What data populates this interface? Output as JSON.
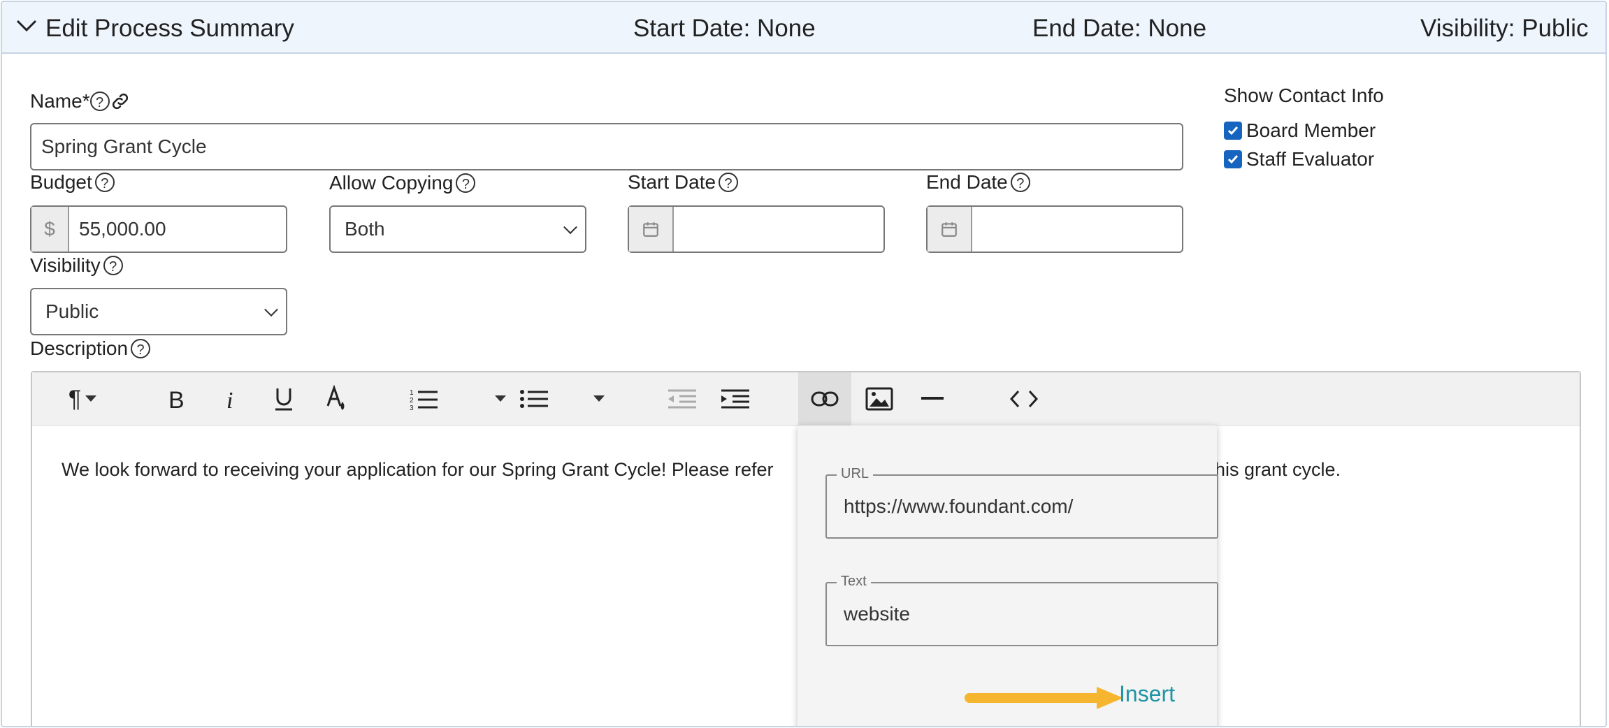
{
  "header": {
    "title": "Edit Process Summary",
    "start_date": "Start Date: None",
    "end_date": "End Date: None",
    "visibility": "Visibility: Public"
  },
  "form": {
    "name_label": "Name*",
    "name_value": "Spring Grant Cycle",
    "budget_label": "Budget",
    "budget_currency": "$",
    "budget_value": "55,000.00",
    "allow_copying_label": "Allow Copying",
    "allow_copying_value": "Both",
    "start_date_label": "Start Date",
    "end_date_label": "End Date",
    "visibility_label": "Visibility",
    "visibility_value": "Public",
    "description_label": "Description",
    "help_glyph": "?"
  },
  "contact": {
    "heading": "Show Contact Info",
    "options": [
      {
        "label": "Board Member",
        "checked": true
      },
      {
        "label": "Staff Evaluator",
        "checked": true
      }
    ]
  },
  "editor": {
    "paragraph_glyph": "¶",
    "content_left": "We look forward to receiving your application for our Spring Grant Cycle! Please refer",
    "content_right": "his grant cycle."
  },
  "link_popup": {
    "url_legend": "URL",
    "url_value": "https://www.foundant.com/",
    "text_legend": "Text",
    "text_value": "website",
    "insert_label": "Insert"
  },
  "colors": {
    "accent": "#1e94a4",
    "checkbox": "#1565c0",
    "annotation_arrow": "#f6b52e"
  }
}
